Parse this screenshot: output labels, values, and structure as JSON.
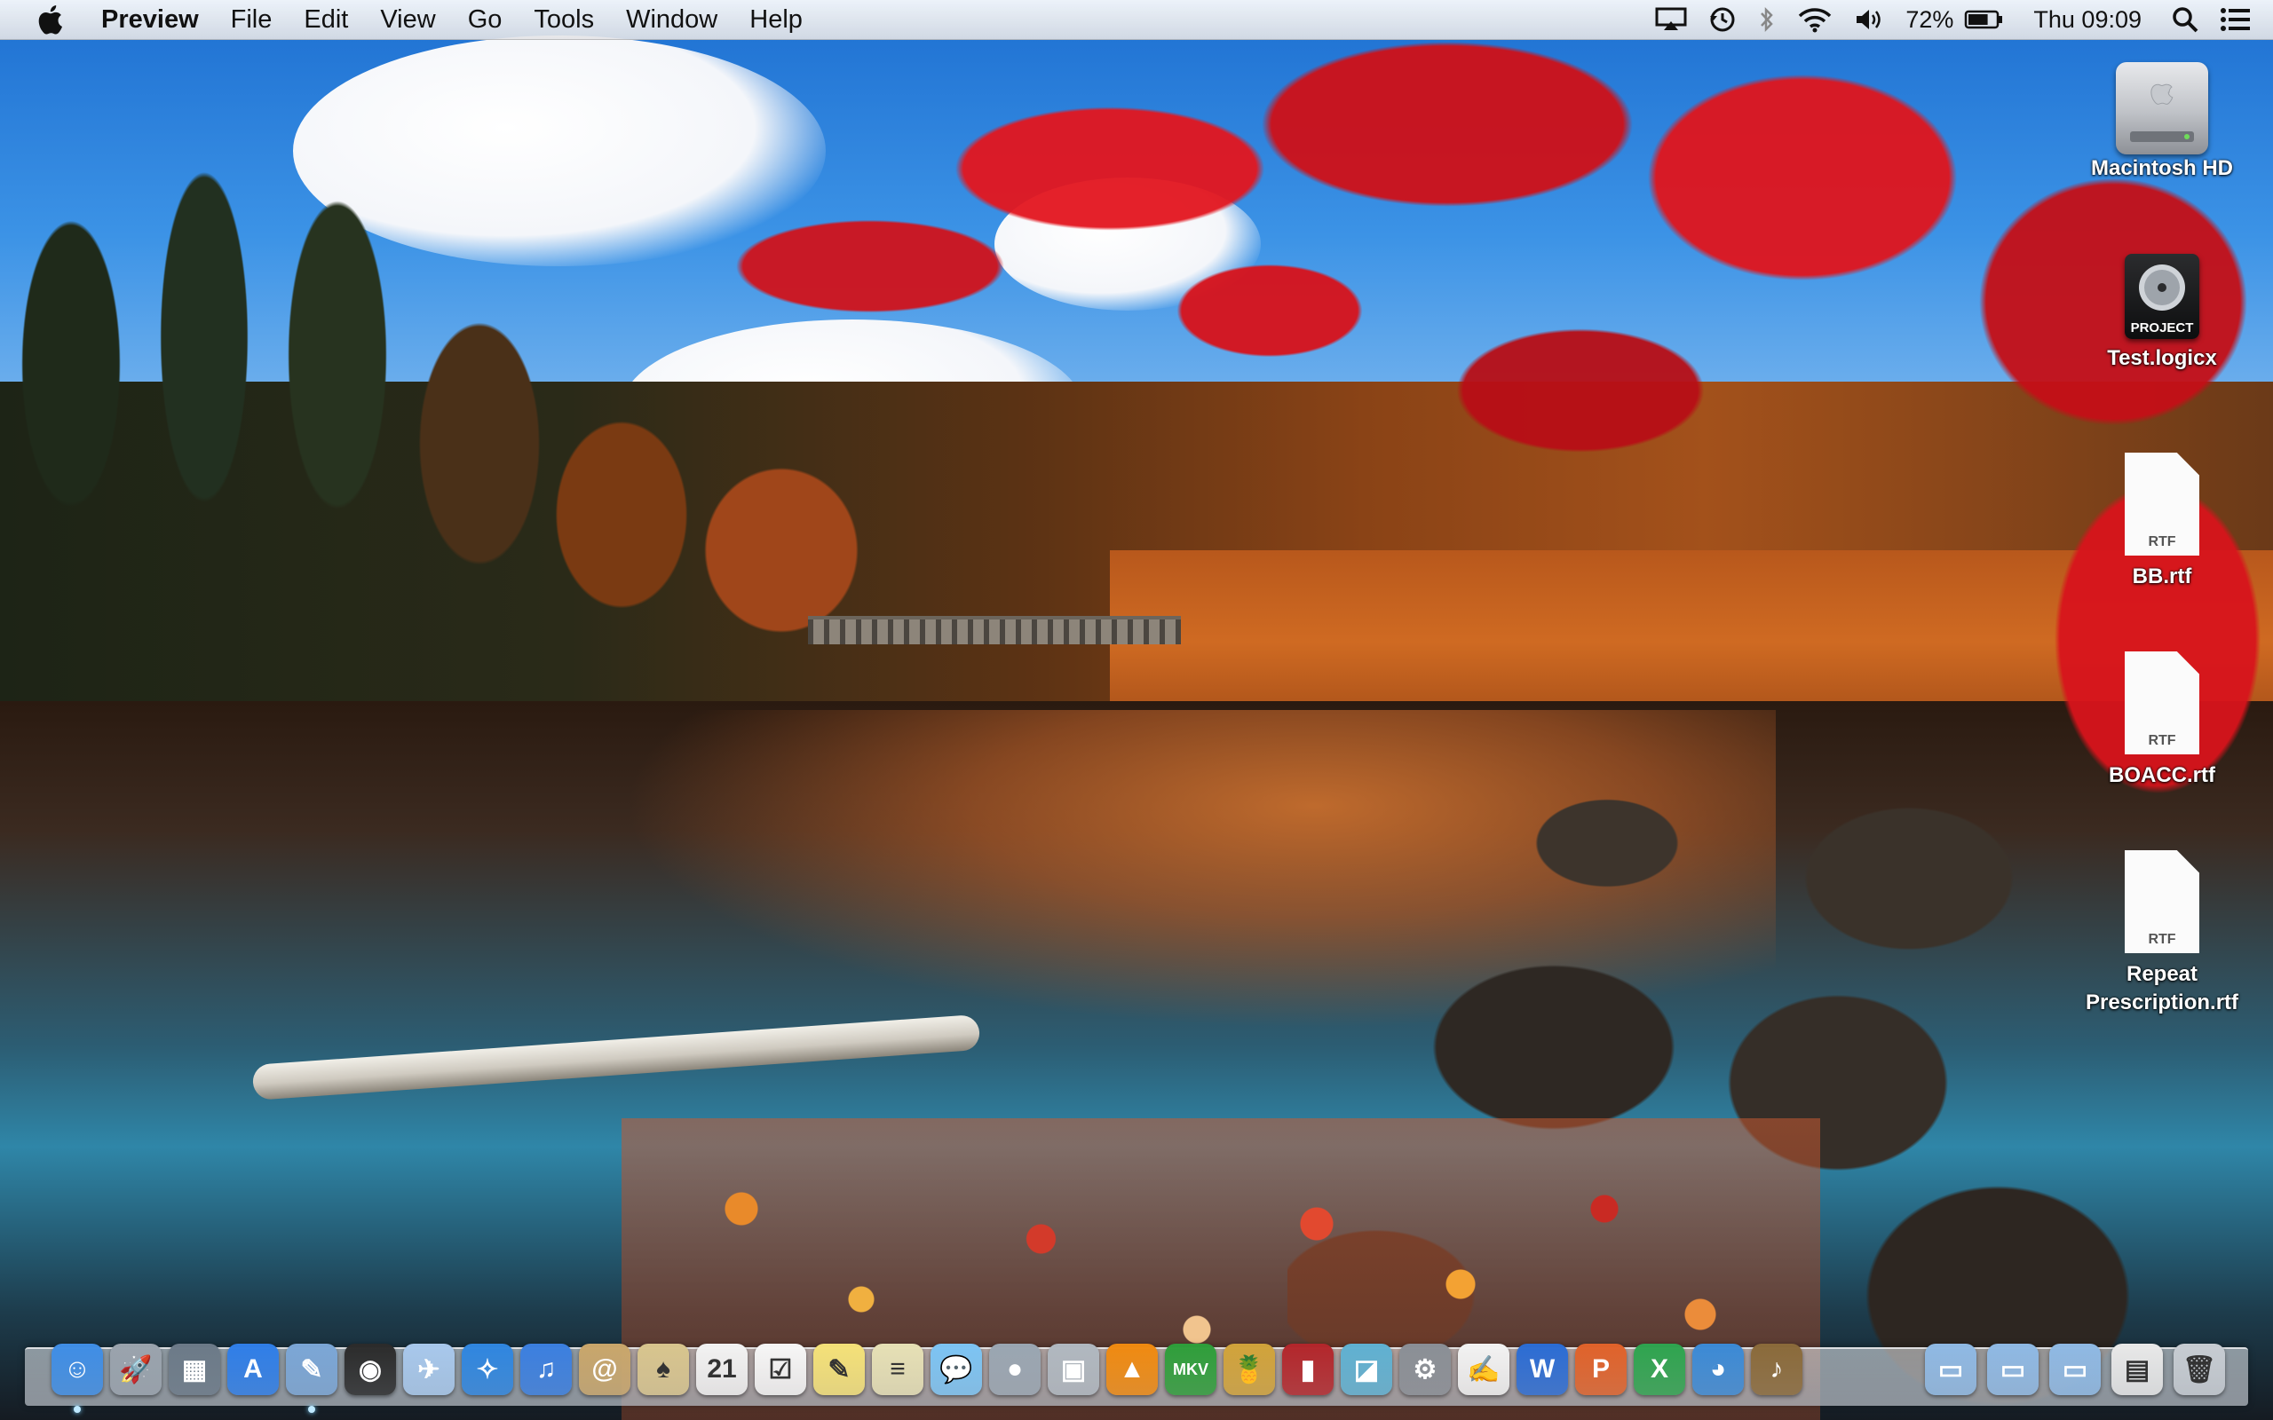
{
  "menubar": {
    "app_name": "Preview",
    "menus": [
      "File",
      "Edit",
      "View",
      "Go",
      "Tools",
      "Window",
      "Help"
    ],
    "status": {
      "airplay": "airplay-icon",
      "time_machine": "time-machine-icon",
      "bluetooth": "bluetooth-icon",
      "wifi": "wifi-icon",
      "volume": "volume-icon",
      "battery_percent": "72%",
      "battery": "battery-icon",
      "clock": "Thu 09:09",
      "spotlight": "spotlight-icon",
      "notifications": "notification-center-icon"
    }
  },
  "desktop": {
    "icons": [
      {
        "name": "Macintosh HD",
        "kind": "hard-drive"
      },
      {
        "name": "Test.logicx",
        "kind": "logic-project",
        "badge": "PROJECT"
      },
      {
        "name": "BB.rtf",
        "kind": "rtf",
        "badge": "RTF"
      },
      {
        "name": "BOACC.rtf",
        "kind": "rtf",
        "badge": "RTF"
      },
      {
        "name": "Repeat\nPrescription.rtf",
        "kind": "rtf",
        "badge": "RTF"
      }
    ]
  },
  "dock": {
    "apps": [
      {
        "icon": "finder-icon",
        "color": "#3f8ee6",
        "glyph": "☺"
      },
      {
        "icon": "launchpad-icon",
        "color": "#9aa3ad",
        "glyph": "🚀"
      },
      {
        "icon": "mission-control-icon",
        "color": "#6c7a88",
        "glyph": "▦"
      },
      {
        "icon": "app-store-icon",
        "color": "#2f7ee8",
        "glyph": "A"
      },
      {
        "icon": "preview-icon",
        "color": "#7ba6d6",
        "glyph": "✎"
      },
      {
        "icon": "facetime-icon",
        "color": "#2b2b2b",
        "glyph": "◉"
      },
      {
        "icon": "mail-icon",
        "color": "#a8c8ec",
        "glyph": "✈"
      },
      {
        "icon": "safari-icon",
        "color": "#2f86e0",
        "glyph": "✧"
      },
      {
        "icon": "itunes-icon",
        "color": "#3b7fe0",
        "glyph": "♫"
      },
      {
        "icon": "contacts-icon",
        "color": "#c9a66b",
        "glyph": "@"
      },
      {
        "icon": "solitaire-icon",
        "color": "#d8c58e",
        "glyph": "♠"
      },
      {
        "icon": "calendar-icon",
        "color": "#f2f2f2",
        "glyph": "21"
      },
      {
        "icon": "reminders-icon",
        "color": "#f6f6f6",
        "glyph": "☑"
      },
      {
        "icon": "notes-icon",
        "color": "#f4e178",
        "glyph": "✎"
      },
      {
        "icon": "stickies-icon",
        "color": "#e6e0b5",
        "glyph": "≡"
      },
      {
        "icon": "messages-icon",
        "color": "#7cc4f4",
        "glyph": "💬"
      },
      {
        "icon": "facetime-camera-icon",
        "color": "#9aa6b2",
        "glyph": "●"
      },
      {
        "icon": "iphoto-icon",
        "color": "#b0b8c0",
        "glyph": "▣"
      },
      {
        "icon": "vlc-icon",
        "color": "#f08a10",
        "glyph": "▲"
      },
      {
        "icon": "mkv-player-icon",
        "color": "#2e9e3a",
        "glyph": "MKV"
      },
      {
        "icon": "pineapple-icon",
        "color": "#d1a33a",
        "glyph": "🍍"
      },
      {
        "icon": "photo-booth-icon",
        "color": "#b3262b",
        "glyph": "▮"
      },
      {
        "icon": "image-capture-icon",
        "color": "#5fb1d2",
        "glyph": "◪"
      },
      {
        "icon": "system-preferences-icon",
        "color": "#8a8f96",
        "glyph": "⚙"
      },
      {
        "icon": "textedit-icon",
        "color": "#f2f2f2",
        "glyph": "✍"
      },
      {
        "icon": "word-icon",
        "color": "#2b6cd4",
        "glyph": "W"
      },
      {
        "icon": "powerpoint-icon",
        "color": "#e0622a",
        "glyph": "P"
      },
      {
        "icon": "excel-icon",
        "color": "#2ea44f",
        "glyph": "X"
      },
      {
        "icon": "network-utility-icon",
        "color": "#3b8ad6",
        "glyph": "◕"
      },
      {
        "icon": "garageband-icon",
        "color": "#8a6a3a",
        "glyph": "♪"
      }
    ],
    "right": [
      {
        "icon": "applications-folder-icon",
        "color": "#8fb9e4",
        "glyph": "▭"
      },
      {
        "icon": "documents-folder-icon",
        "color": "#8fb9e4",
        "glyph": "▭"
      },
      {
        "icon": "downloads-folder-icon",
        "color": "#8fb9e4",
        "glyph": "▭"
      },
      {
        "icon": "recent-document-icon",
        "color": "#e8e8e8",
        "glyph": "▤"
      },
      {
        "icon": "trash-icon",
        "color": "#c7ccd2",
        "glyph": "🗑"
      }
    ]
  }
}
